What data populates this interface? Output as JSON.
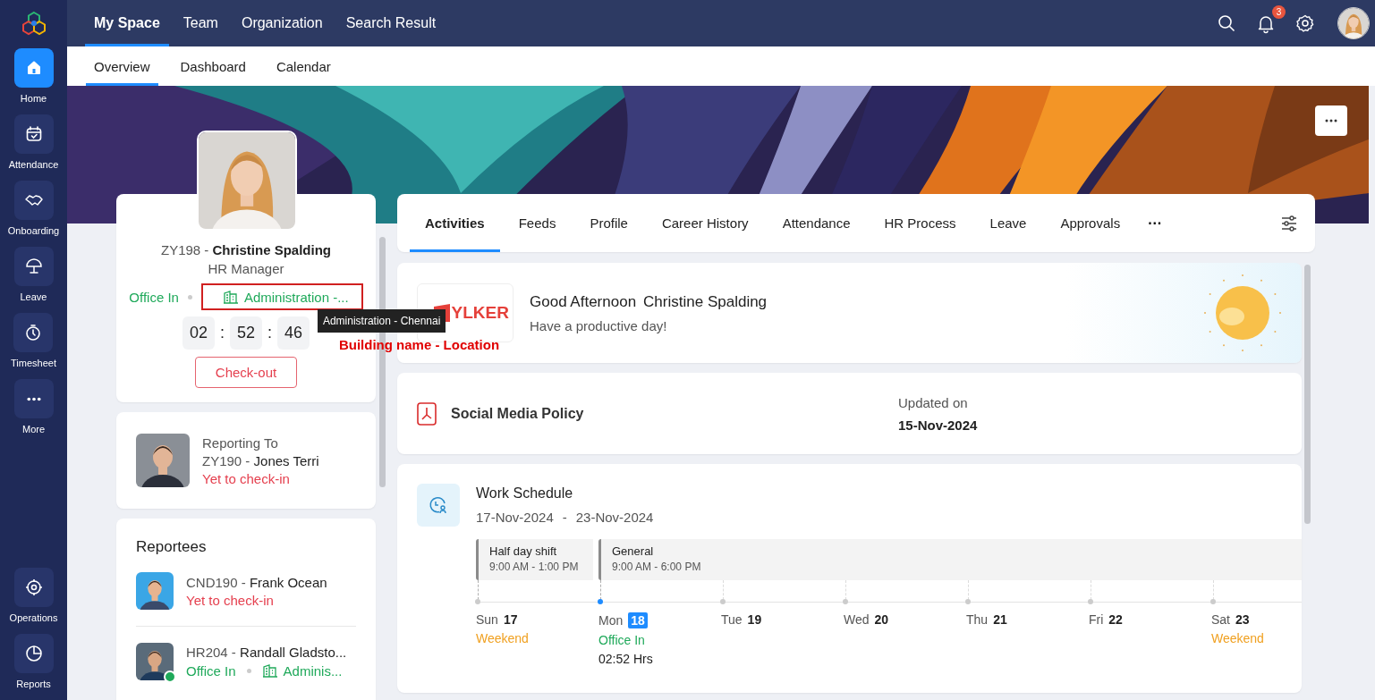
{
  "sidebar": {
    "items": [
      {
        "label": "Home",
        "selected": true
      },
      {
        "label": "Attendance",
        "selected": false
      },
      {
        "label": "Onboarding",
        "selected": false
      },
      {
        "label": "Leave",
        "selected": false
      },
      {
        "label": "Timesheet",
        "selected": false
      },
      {
        "label": "More",
        "selected": false
      }
    ],
    "bottom_items": [
      {
        "label": "Operations",
        "selected": false
      },
      {
        "label": "Reports",
        "selected": false
      }
    ]
  },
  "top_nav": {
    "tabs": [
      {
        "label": "My Space",
        "selected": true
      },
      {
        "label": "Team",
        "selected": false
      },
      {
        "label": "Organization",
        "selected": false
      },
      {
        "label": "Search Result",
        "selected": false
      }
    ],
    "notification_count": "3"
  },
  "sub_nav": {
    "tabs": [
      {
        "label": "Overview",
        "selected": true
      },
      {
        "label": "Dashboard",
        "selected": false
      },
      {
        "label": "Calendar",
        "selected": false
      }
    ]
  },
  "profile": {
    "id": "ZY198",
    "separator": " - ",
    "name": "Christine Spalding",
    "role": "HR Manager",
    "status": "Office In",
    "location": "Administration -...",
    "timer": [
      "02",
      "52",
      "46"
    ],
    "timer_separator": ":",
    "button": "Check-out",
    "tooltip": "Administration - Chennai",
    "annotation": "Building name - Location"
  },
  "reporting": {
    "label": "Reporting To",
    "id": "ZY190",
    "separator": " - ",
    "name": "Jones Terri",
    "status": "Yet to check-in",
    "kind": "absent"
  },
  "reportees": {
    "title": "Reportees",
    "items": [
      {
        "id": "CND190",
        "separator": " - ",
        "name": "Frank Ocean",
        "status": "Yet to check-in",
        "kind": "absent",
        "online": false
      },
      {
        "id": "HR204",
        "separator": " - ",
        "name": "Randall Gladsto...",
        "status": "Office In",
        "kind": "present",
        "location": "Adminis...",
        "online": true
      }
    ]
  },
  "activity_tabs": {
    "tabs": [
      {
        "label": "Activities",
        "selected": true
      },
      {
        "label": "Feeds",
        "selected": false
      },
      {
        "label": "Profile",
        "selected": false
      },
      {
        "label": "Career History",
        "selected": false
      },
      {
        "label": "Attendance",
        "selected": false
      },
      {
        "label": "HR Process",
        "selected": false
      },
      {
        "label": "Leave",
        "selected": false
      },
      {
        "label": "Approvals",
        "selected": false
      }
    ],
    "more": "···"
  },
  "greeting": {
    "logo": "YLKER",
    "title": "Good Afternoon",
    "name": "Christine Spalding",
    "message": "Have a productive day!"
  },
  "policy": {
    "title": "Social Media Policy",
    "updated_label": "Updated on",
    "updated_date": "15-Nov-2024"
  },
  "schedule": {
    "title": "Work Schedule",
    "range_start": "17-Nov-2024",
    "range_separator": "-",
    "range_end": "23-Nov-2024",
    "shifts": [
      {
        "name": "Half day shift",
        "time": "9:00 AM - 1:00 PM"
      },
      {
        "name": "General",
        "time": "9:00 AM - 6:00 PM"
      }
    ],
    "days": [
      {
        "day": "Sun",
        "date": "17",
        "today": false,
        "shift_start": true,
        "status": "Weekend",
        "kind": "weekend"
      },
      {
        "day": "Mon",
        "date": "18",
        "today": true,
        "shift_start": true,
        "status": "Office In",
        "kind": "present",
        "hours": "02:52 Hrs"
      },
      {
        "day": "Tue",
        "date": "19",
        "today": false,
        "shift_start": false
      },
      {
        "day": "Wed",
        "date": "20",
        "today": false,
        "shift_start": false
      },
      {
        "day": "Thu",
        "date": "21",
        "today": false,
        "shift_start": false
      },
      {
        "day": "Fri",
        "date": "22",
        "today": false,
        "shift_start": false
      },
      {
        "day": "Sat",
        "date": "23",
        "today": false,
        "shift_start": false,
        "status": "Weekend",
        "kind": "weekend"
      }
    ]
  }
}
